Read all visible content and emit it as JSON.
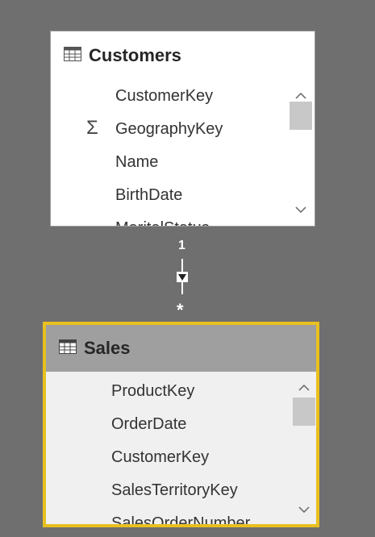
{
  "tables": {
    "customers": {
      "title": "Customers",
      "fields": [
        {
          "label": "CustomerKey",
          "icon": ""
        },
        {
          "label": "GeographyKey",
          "icon": "sigma-icon",
          "glyph": "Σ"
        },
        {
          "label": "Name",
          "icon": ""
        },
        {
          "label": "BirthDate",
          "icon": ""
        },
        {
          "label": "MaritalStatus",
          "icon": ""
        }
      ]
    },
    "sales": {
      "title": "Sales",
      "fields": [
        {
          "label": "ProductKey"
        },
        {
          "label": "OrderDate"
        },
        {
          "label": "CustomerKey"
        },
        {
          "label": "SalesTerritoryKey"
        },
        {
          "label": "SalesOrderNumber"
        }
      ]
    }
  },
  "relationship": {
    "one_side": "1",
    "many_side": "*"
  },
  "colors": {
    "canvas": "#6f6f6f",
    "selected_border": "#e8c020",
    "selected_header": "#9f9f9f"
  }
}
